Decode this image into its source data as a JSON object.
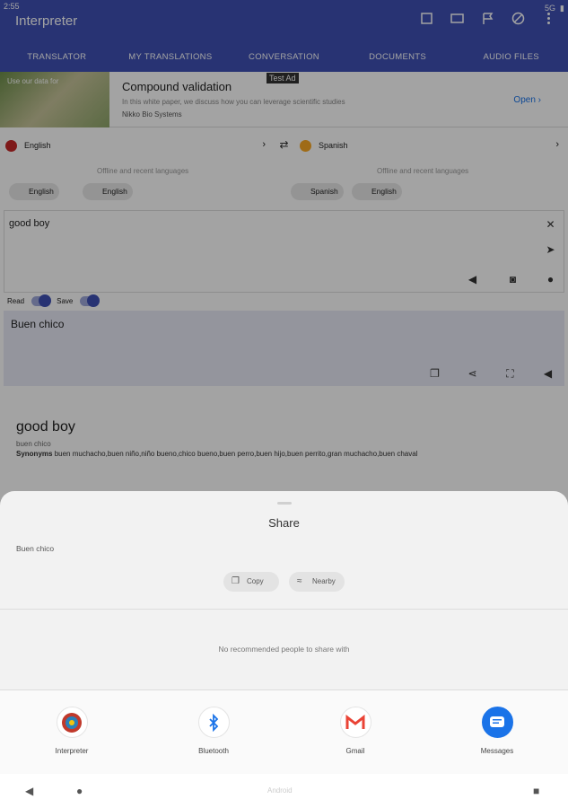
{
  "status": {
    "time": "2:55",
    "signal": "5G"
  },
  "app": {
    "title": "Interpreter",
    "tabs": [
      "TRANSLATOR",
      "MY TRANSLATIONS",
      "CONVERSATION",
      "DOCUMENTS",
      "AUDIO FILES"
    ]
  },
  "ad": {
    "image_text": "Use our data for",
    "badge": "Test Ad",
    "title": "Compound validation",
    "subtitle": "In this white paper, we discuss how you can leverage scientific studies",
    "advertiser": "Nikko Bio Systems",
    "open_label": "Open"
  },
  "languages": {
    "source": "English",
    "target": "Spanish",
    "offline_hint": "Offline and recent languages",
    "source_chips": [
      "English",
      "English"
    ],
    "target_chips": [
      "Spanish",
      "English"
    ]
  },
  "input": {
    "text": "good boy"
  },
  "toggles": {
    "read": "Read",
    "save": "Save"
  },
  "output": {
    "text": "Buen chico"
  },
  "dictionary": {
    "word": "good boy",
    "translation": "buen chico",
    "synonyms_label": "Synonyms",
    "synonyms": "buen muchacho,buen niño,niño bueno,chico bueno,buen perro,buen hijo,buen perrito,gran muchacho,buen chaval"
  },
  "share": {
    "title": "Share",
    "preview": "Buen chico",
    "copy_label": "Copy",
    "nearby_label": "Nearby",
    "no_people": "No recommended people to share with",
    "targets": [
      {
        "label": "Interpreter",
        "icon": "interpreter-app-icon"
      },
      {
        "label": "Bluetooth",
        "icon": "bluetooth-icon"
      },
      {
        "label": "Gmail",
        "icon": "gmail-icon"
      },
      {
        "label": "Messages",
        "icon": "messages-icon"
      }
    ]
  },
  "navbar": {
    "center_text": "Android"
  },
  "colors": {
    "primary": "#3f51b5",
    "sheet_bg": "#f2f2f2",
    "messages_blue": "#1a73e8",
    "gmail_red": "#ea4335"
  }
}
